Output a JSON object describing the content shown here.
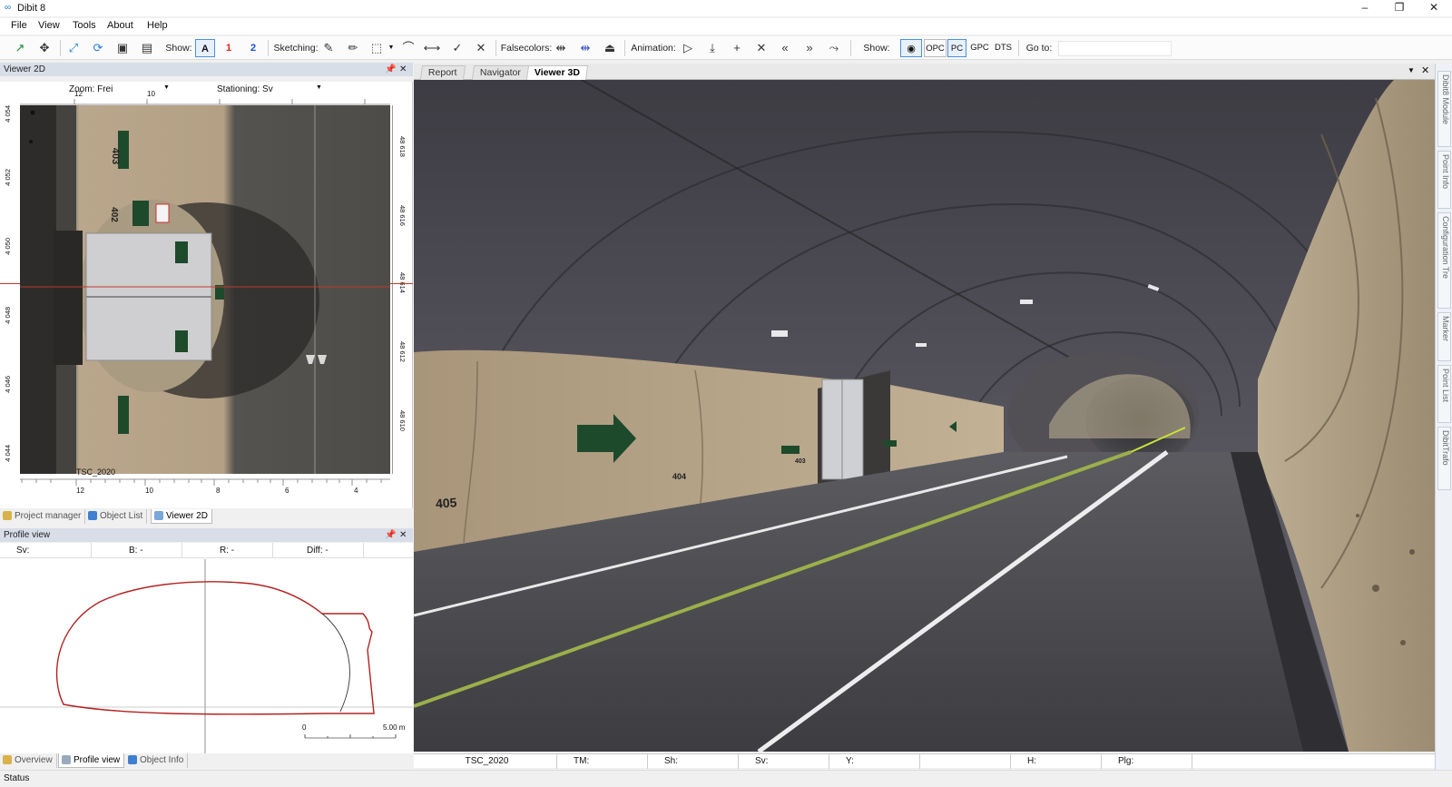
{
  "window": {
    "title": "Dibit 8",
    "minimize": "–",
    "restore": "❐",
    "close": "✕"
  },
  "menu": [
    "File",
    "View",
    "Tools",
    "About",
    "Help"
  ],
  "toolbar": {
    "show_label": "Show:",
    "show_a": "A",
    "show_1": "1",
    "show_2": "2",
    "sketching_label": "Sketching:",
    "falsecolors_label": "Falsecolors:",
    "animation_label": "Animation:",
    "show2_label": "Show:",
    "opc": "OPC",
    "pc": "PC",
    "gpc": "GPC",
    "dts": "DTS",
    "goto_label": "Go to:",
    "goto_value": ""
  },
  "viewer2d": {
    "title": "Viewer 2D",
    "zoom": "Zoom: Frei",
    "stationing": "Stationing: Sv",
    "top_ticks": [
      "12",
      "10"
    ],
    "bottom_ticks": [
      "12",
      "10",
      "8",
      "6",
      "4"
    ],
    "left_ticks": [
      "4 054",
      "4 052",
      "4 050",
      "4 048",
      "4 046",
      "4 044"
    ],
    "right_ticks": [
      "48 618",
      "48 616",
      "48 614",
      "48 612",
      "48 610"
    ],
    "scan_label": "TSC_2020",
    "wall_numbers": [
      "403",
      "402"
    ]
  },
  "left_tabs": [
    "Project manager",
    "Object List",
    "Viewer 2D"
  ],
  "profile": {
    "title": "Profile view",
    "cols": [
      "Sv:",
      "B: -",
      "R: -",
      "Diff: -"
    ],
    "scale_start": "0",
    "scale_end": "5.00 m"
  },
  "bottom_tabs": [
    "Overview",
    "Profile view",
    "Object Info"
  ],
  "viewer3d": {
    "tabs": [
      "Report",
      "Navigator",
      "Viewer 3D"
    ],
    "wall_numbers": [
      "405",
      "404",
      "403"
    ]
  },
  "statusbar": [
    "TSC_2020",
    "TM:",
    "Sh:",
    "Sv:",
    "Y:",
    "",
    "H:",
    "Plg:"
  ],
  "status": "Status",
  "right_dock": [
    "Dibit8 Module",
    "Point Info",
    "Configuration Tre",
    "Marker",
    "Point List",
    "DibitTrafo"
  ],
  "colors": {
    "accent": "#4a90d9",
    "panel_header": "#d7dee8",
    "profile_line": "#b22222",
    "sign_green": "#1e4a2c"
  }
}
